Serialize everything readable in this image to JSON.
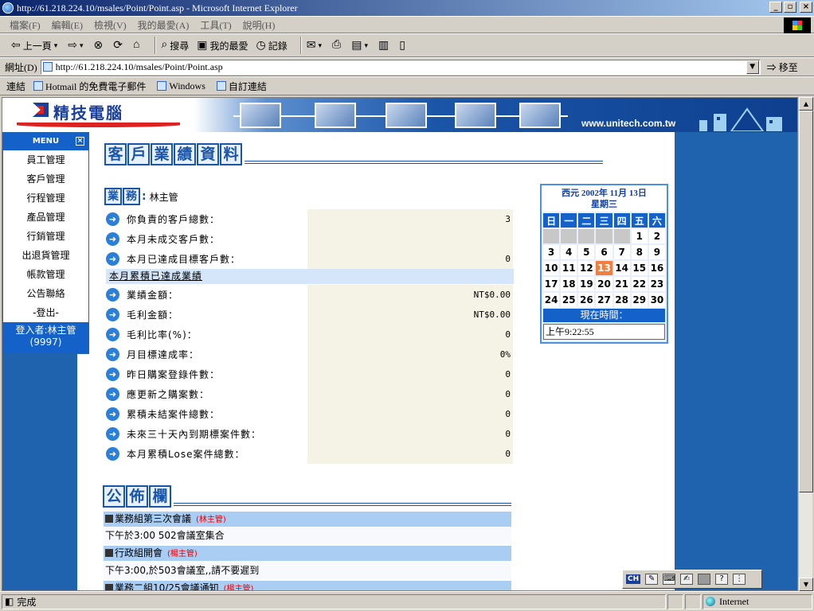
{
  "window": {
    "title": "http://61.218.224.10/msales/Point/Point.asp - Microsoft Internet Explorer",
    "minimize": "_",
    "maximize": "▫",
    "close": "×"
  },
  "menubar": [
    "檔案(F)",
    "編輯(E)",
    "檢視(V)",
    "我的最愛(A)",
    "工具(T)",
    "說明(H)"
  ],
  "toolbar": {
    "back": "上一頁",
    "search": "搜尋",
    "favorites": "我的最愛",
    "history": "記錄"
  },
  "addressbar": {
    "label": "網址(D)",
    "url": "http://61.218.224.10/msales/Point/Point.asp",
    "go": "移至"
  },
  "linksbar": {
    "label": "連結",
    "links": [
      "Hotmail 的免費電子郵件",
      "Windows",
      "自訂連結"
    ]
  },
  "banner": {
    "logo": "精技電腦",
    "url": "www.unitech.com.tw"
  },
  "leftmenu": {
    "header": "MENU",
    "close": "×",
    "items": [
      "員工管理",
      "客戶管理",
      "行程管理",
      "產品管理",
      "行銷管理",
      "出退貨管理",
      "帳款管理",
      "公告聯絡",
      "-登出-"
    ],
    "login_line1": "登入者:林主管",
    "login_line2": "(9997)"
  },
  "page_title": [
    "客",
    "戶",
    "業",
    "績",
    "資",
    "料"
  ],
  "sales": {
    "label": [
      "業",
      "務"
    ],
    "colon": ":",
    "name": "林主管"
  },
  "stats_top": [
    {
      "label": "你負責的客戶總數：",
      "value": "3"
    },
    {
      "label": "本月未成交客戶數：",
      "value": ""
    },
    {
      "label": "本月已達成目標客戶數：",
      "value": "0"
    }
  ],
  "month_section": "本月累積已達成業績",
  "stats_bottom": [
    {
      "label": "業績金額：",
      "value": "NT$0.00"
    },
    {
      "label": "毛利金額：",
      "value": "NT$0.00"
    },
    {
      "label": "毛利比率(%)：",
      "value": "0"
    },
    {
      "label": "月目標達成率：",
      "value": "0%"
    },
    {
      "label": "昨日購案登錄件數：",
      "value": "0"
    },
    {
      "label": "應更新之購案數：",
      "value": "0"
    },
    {
      "label": "累積未結案件總數：",
      "value": "0"
    },
    {
      "label": "未來三十天內到期標案件數：",
      "value": "0"
    },
    {
      "label": "本月累積Lose案件總數：",
      "value": "0"
    }
  ],
  "calendar": {
    "heading_line1": "西元 2002年 11月 13日",
    "heading_line2": "星期三",
    "weekdays": [
      "日",
      "一",
      "二",
      "三",
      "四",
      "五",
      "六"
    ],
    "weeks": [
      [
        "",
        "",
        "",
        "",
        "",
        "1",
        "2"
      ],
      [
        "3",
        "4",
        "5",
        "6",
        "7",
        "8",
        "9"
      ],
      [
        "10",
        "11",
        "12",
        "13",
        "14",
        "15",
        "16"
      ],
      [
        "17",
        "18",
        "19",
        "20",
        "21",
        "22",
        "23"
      ],
      [
        "24",
        "25",
        "26",
        "27",
        "28",
        "29",
        "30"
      ]
    ],
    "today": "13",
    "now_label": "現在時間：",
    "now_value": "上午9:22:55"
  },
  "bulletin_title": [
    "公",
    "佈",
    "欄"
  ],
  "bulletin": [
    {
      "title": "業務組第三次會議",
      "author": "(林主管)",
      "body": "下午於3:00 502會議室集合"
    },
    {
      "title": "行政組開會",
      "author": "(楊主管)",
      "body": "下午3:00,於503會議室,,請不要遲到"
    },
    {
      "title": "業務二組10/25會議通知",
      "author": "(楊主管)",
      "body": ""
    }
  ],
  "langbar": {
    "lang": "CH"
  },
  "statusbar": {
    "status": "完成",
    "zone": "Internet"
  },
  "colors": {
    "accent_blue": "#1462c9",
    "page_bg_blue": "#1f62ad",
    "today_orange": "#f08040",
    "author_red": "#e00000"
  }
}
